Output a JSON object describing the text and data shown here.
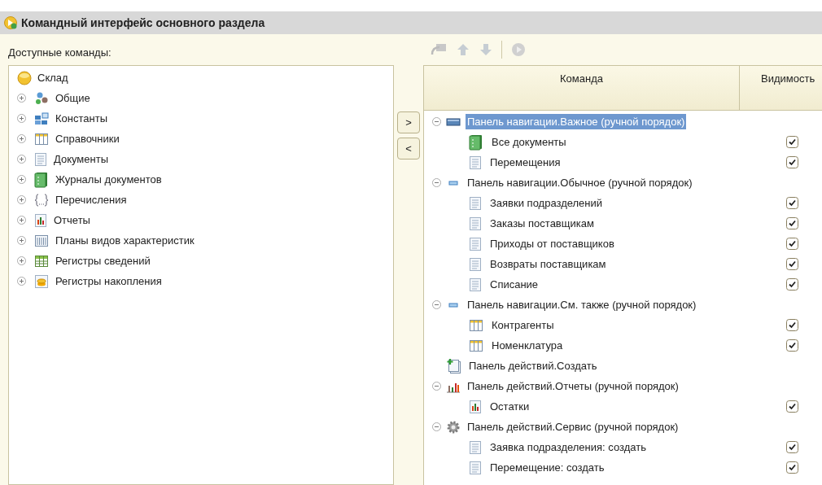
{
  "window": {
    "title": "Командный интерфейс основного раздела"
  },
  "available": {
    "label": "Доступные команды:",
    "tree": [
      {
        "text": "Склад",
        "kind": "section",
        "children": [
          {
            "text": "Общие",
            "kind": "common",
            "expanded": false
          },
          {
            "text": "Константы",
            "kind": "constants",
            "expanded": false
          },
          {
            "text": "Справочники",
            "kind": "catalog",
            "expanded": false
          },
          {
            "text": "Документы",
            "kind": "document",
            "expanded": false
          },
          {
            "text": "Журналы документов",
            "kind": "journal",
            "expanded": false
          },
          {
            "text": "Перечисления",
            "kind": "enum",
            "expanded": false
          },
          {
            "text": "Отчеты",
            "kind": "report",
            "expanded": false
          },
          {
            "text": "Планы видов характеристик",
            "kind": "chartypes",
            "expanded": false
          },
          {
            "text": "Регистры сведений",
            "kind": "inforeg",
            "expanded": false
          },
          {
            "text": "Регистры накопления",
            "kind": "accumreg",
            "expanded": false
          }
        ]
      }
    ]
  },
  "move_buttons": [
    ">",
    "<"
  ],
  "commands": {
    "columns": [
      "Команда",
      "Видимость"
    ],
    "rows": [
      {
        "text": "Панель навигации.Важное (ручной порядок)",
        "kind": "navbig",
        "expanded": true,
        "selected": true,
        "children": [
          {
            "text": "Все документы",
            "kind": "journal",
            "selected": false,
            "visible": true
          },
          {
            "text": "Перемещения",
            "kind": "document",
            "selected": false,
            "visible": true
          }
        ]
      },
      {
        "text": "Панель навигации.Обычное (ручной порядок)",
        "kind": "navsmall",
        "expanded": true,
        "selected": false,
        "children": [
          {
            "text": "Заявки подразделений",
            "kind": "document",
            "selected": false,
            "visible": true
          },
          {
            "text": "Заказы поставщикам",
            "kind": "document",
            "selected": false,
            "visible": true
          },
          {
            "text": "Приходы от поставщиков",
            "kind": "document",
            "selected": false,
            "visible": true
          },
          {
            "text": "Возвраты поставщикам",
            "kind": "document",
            "selected": false,
            "visible": true
          },
          {
            "text": "Списание",
            "kind": "document",
            "selected": false,
            "visible": true
          }
        ]
      },
      {
        "text": "Панель навигации.См. также (ручной порядок)",
        "kind": "navsmall",
        "expanded": true,
        "selected": false,
        "children": [
          {
            "text": "Контрагенты",
            "kind": "catalog",
            "selected": false,
            "visible": true
          },
          {
            "text": "Номенклатура",
            "kind": "catalog",
            "selected": false,
            "visible": true
          }
        ]
      },
      {
        "text": "Панель действий.Создать",
        "kind": "create",
        "selected": false
      },
      {
        "text": "Панель действий.Отчеты (ручной порядок)",
        "kind": "reportsbar",
        "expanded": true,
        "selected": false,
        "children": [
          {
            "text": "Остатки",
            "kind": "report",
            "selected": false,
            "visible": true
          }
        ]
      },
      {
        "text": "Панель действий.Сервис (ручной порядок)",
        "kind": "gear",
        "expanded": true,
        "selected": false,
        "children": [
          {
            "text": "Заявка подразделения: создать",
            "kind": "document",
            "selected": false,
            "visible": true
          },
          {
            "text": "Перемещение: создать",
            "kind": "document",
            "selected": false,
            "visible": true
          }
        ]
      }
    ]
  }
}
